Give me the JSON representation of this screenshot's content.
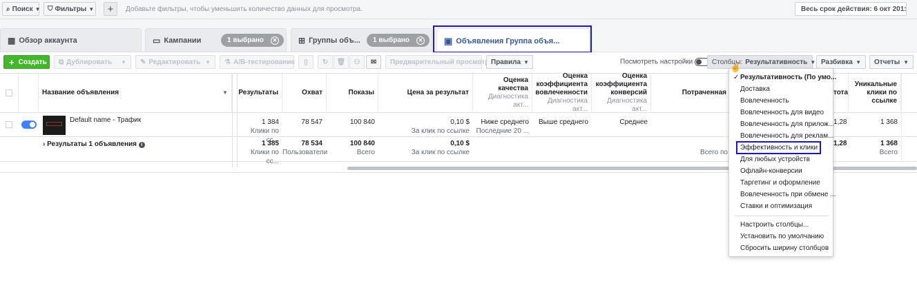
{
  "filterbar": {
    "search": "Поиск",
    "filters": "Фильтры",
    "add": "+",
    "hint": "Добавьте фильтры, чтобы уменьшить количество данных для просмотра.",
    "daterange": "Весь срок действия: 6 окт 201:"
  },
  "tabs": {
    "overview": "Обзор аккаунта",
    "campaigns": "Кампании",
    "campaigns_pill": "1 выбрано",
    "adsets": "Группы объ...",
    "adsets_pill": "1 выбрано",
    "ads": "Объявления Группа объя..."
  },
  "toolbar": {
    "create": "Создать",
    "duplicate": "Дублировать",
    "edit": "Редактировать",
    "abtest": "A/B-тестирование",
    "preview": "Предварительный просмотр",
    "rules": "Правила",
    "view_settings": "Посмотреть настройки",
    "columns_prefix": "Столбцы:",
    "columns_value": "Результативность",
    "breakdown": "Разбивка",
    "reports": "Отчеты"
  },
  "table": {
    "headers": {
      "name": "Название объявления",
      "results": "Результаты",
      "reach": "Охват",
      "impressions": "Показы",
      "cost_per_result": "Цена за результат",
      "quality_l1": "Оценка качества",
      "quality_sub": "Диагностика акт...",
      "engage_l1": "Оценка",
      "engage_l2": "коэффициента",
      "engage_l3": "вовлеченности",
      "engage_sub": "Диагностика акт...",
      "conv_l1": "Оценка",
      "conv_l2": "коэффициента",
      "conv_l3": "конверсий",
      "conv_sub": "Диагностика акт...",
      "spent": "Потраченная",
      "total": "тота",
      "unique_l1": "Уникальные",
      "unique_l2": "клики по",
      "unique_l3": "ссылке"
    },
    "row1": {
      "name": "Default name - Трафик",
      "results": "1 384",
      "results_sub": "Клики по сс...",
      "reach": "78 547",
      "impressions": "100 840",
      "cpr": "0,10 $",
      "cpr_sub": "За клик по ссылке",
      "quality": "Ниже среднего",
      "quality_sub": "Последние 20 ...",
      "engage": "Выше среднего",
      "conv": "Среднее",
      "total": "1,28",
      "unique": "1 368"
    },
    "row2": {
      "name": "Результаты 1 объявления",
      "results": "1 385",
      "results_sub": "Клики по сс...",
      "reach": "78 534",
      "reach_sub": "Пользователи",
      "impressions": "100 840",
      "impressions_sub": "Всего",
      "cpr": "0,10 $",
      "cpr_sub": "За клик по ссылке",
      "spent_sub": "Всего по",
      "total": "1,28",
      "unique": "1 368",
      "unique_sub": "Всего"
    }
  },
  "menu": {
    "items": [
      "Результативность (По умо...",
      "Доставка",
      "Вовлеченность",
      "Вовлеченность для видео",
      "Вовлеченность для прилож...",
      "Вовлеченность для реклам...",
      "Эффективность и клики",
      "Для любых устройств",
      "Офлайн-конверсии",
      "Таргетинг и оформление",
      "Вовлеченность при обмене ...",
      "Ставки и оптимизация"
    ],
    "actions": [
      "Настроить столбцы...",
      "Установить по умолчанию",
      "Сбросить ширину столбцов"
    ],
    "check": "✓"
  },
  "colors": {
    "highlight": "#1a14c9",
    "create_green": "#42b72a",
    "toggle_blue": "#4080ff",
    "pill_gray": "#9da1a6"
  }
}
